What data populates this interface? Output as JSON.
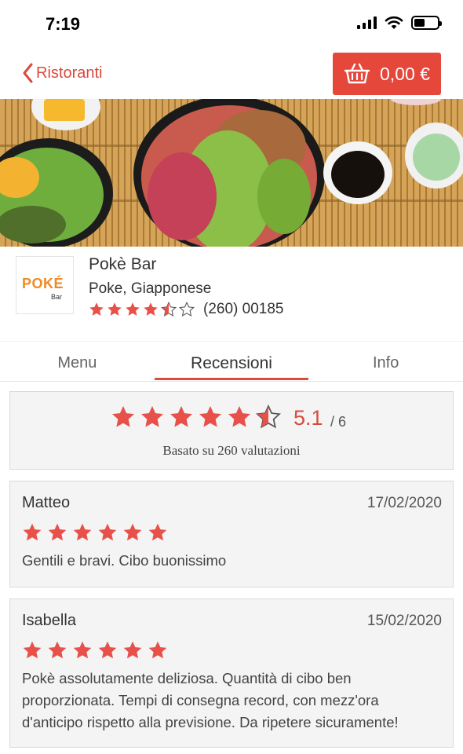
{
  "status_bar": {
    "time": "7:19"
  },
  "nav": {
    "back_label": "Ristoranti",
    "cart_total": "0,00 €"
  },
  "restaurant": {
    "logo_text": "POKÉ",
    "logo_subtext": "Bar",
    "name": "Pokè Bar",
    "cuisine": "Poke, Giapponese",
    "rating_stars": 4.5,
    "rating_count": "(260) 00185"
  },
  "tabs": [
    {
      "label": "Menu",
      "active": false
    },
    {
      "label": "Recensioni",
      "active": true
    },
    {
      "label": "Info",
      "active": false
    }
  ],
  "summary": {
    "stars": 5.5,
    "max_stars": 6,
    "score": "5.1",
    "out_of": "/ 6",
    "basis": "Basato su 260 valutazioni"
  },
  "reviews": [
    {
      "author": "Matteo",
      "date": "17/02/2020",
      "stars": 6,
      "text": "Gentili e bravi. Cibo buonissimo"
    },
    {
      "author": "Isabella",
      "date": "15/02/2020",
      "stars": 6,
      "text": "Pokè assolutamente deliziosa. Quantità di cibo ben proporzionata. Tempi di consegna record, con mezz'ora d'anticipo rispetto alla previsione. Da ripetere sicuramente!"
    }
  ],
  "colors": {
    "accent": "#d94b3c",
    "cart_bg": "#e5473b",
    "star": "#e8514a"
  }
}
